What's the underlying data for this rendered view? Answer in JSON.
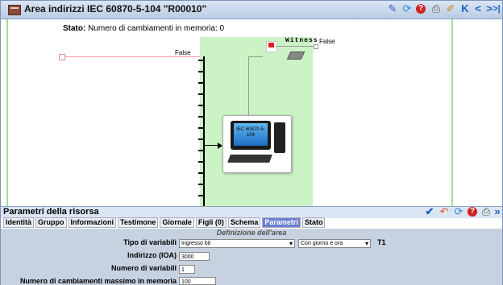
{
  "window": {
    "title": "Area indirizzi IEC 60870-5-104 \"R00010\"",
    "toolbar": {
      "icons": [
        "pencil-icon",
        "refresh-icon",
        "help-icon",
        "print-icon",
        "edit-icon",
        "first-icon",
        "prev-icon",
        "next-icon",
        "last-icon"
      ],
      "glyphs": [
        "✎",
        "⟳",
        "?",
        "⎙",
        "✐",
        "K",
        "<",
        ">",
        ">|"
      ]
    }
  },
  "diagram": {
    "status_label": "Stato:",
    "status_text": "Numero di cambiamenti in memoria: 0",
    "false_left": "False",
    "witness_label": "Witness",
    "false_right": "False",
    "device_text": "IEC 60870-5-104"
  },
  "panel": {
    "title": "Parametri della risorsa",
    "actions": [
      "✔",
      "↶",
      "⟳",
      "?",
      "⎙",
      "»"
    ],
    "tabs": [
      "Identità",
      "Gruppo",
      "Informazioni",
      "Testimone",
      "Giornale",
      "Figli (0)",
      "Schema",
      "Parametri",
      "Stato"
    ],
    "active_tab": "Parametri",
    "section_title": "Definizione dell'area",
    "fields": {
      "tipo_label": "Tipo di variabili",
      "tipo_value": "Ingresso bit",
      "tipo2_value": "Con giorno e ora",
      "tipo_suffix": "T1",
      "indirizzo_label": "Indirizzo (IOA)",
      "indirizzo_value": "3000",
      "numero_label": "Numero di variabili",
      "numero_value": "1",
      "max_label": "Numero di cambiamenti massimo in memoria",
      "max_value": "100"
    }
  },
  "colors": {
    "green_zone": "#ccf3c5",
    "active_tab": "#6b7fd0",
    "toolbar_blue": "#2060c0",
    "help_red": "#d02020"
  }
}
